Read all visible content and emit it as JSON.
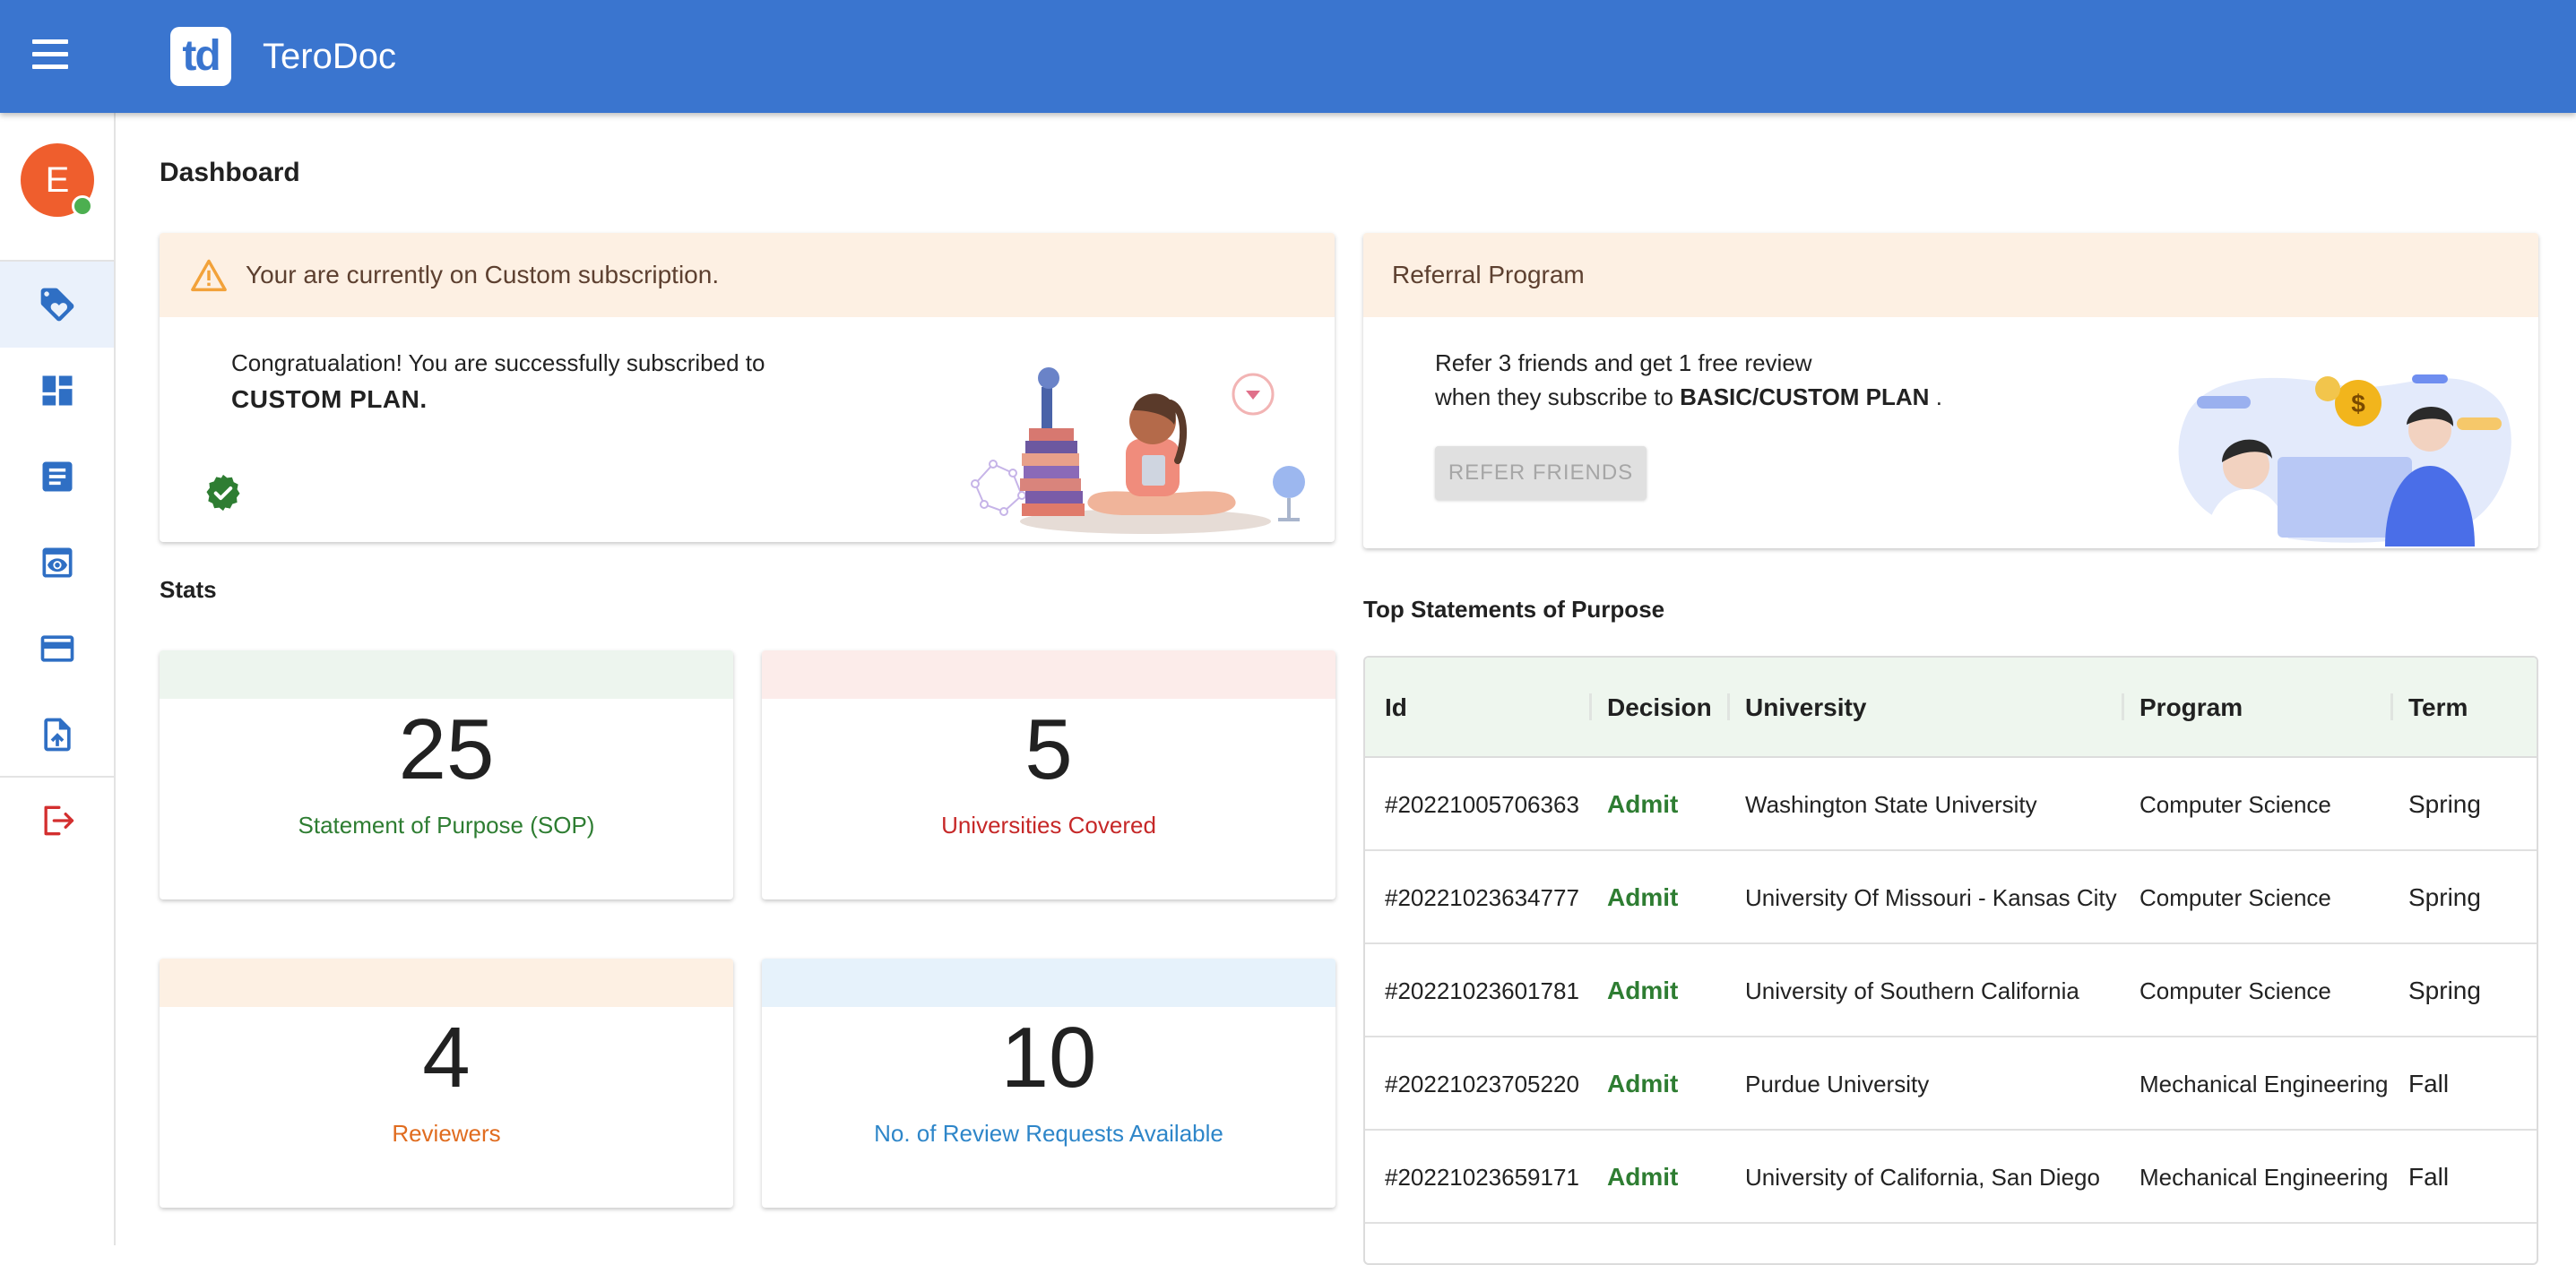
{
  "app": {
    "logo_text": "td",
    "title": "TeroDoc"
  },
  "user": {
    "avatar_initial": "E",
    "status": "online"
  },
  "sidebar": {
    "items": [
      {
        "icon": "tag-heart-icon",
        "active": true
      },
      {
        "icon": "dashboard-icon",
        "active": false
      },
      {
        "icon": "document-icon",
        "active": false
      },
      {
        "icon": "preview-eye-icon",
        "active": false
      },
      {
        "icon": "credit-card-icon",
        "active": false
      },
      {
        "icon": "file-upload-icon",
        "active": false
      },
      {
        "icon": "logout-icon",
        "active": false
      }
    ]
  },
  "page": {
    "title": "Dashboard"
  },
  "subscription": {
    "alert": "Your are currently on Custom subscription.",
    "message": "Congratualation! You are successfully subscribed to",
    "plan": "CUSTOM PLAN.",
    "icon": "verified-badge-icon",
    "alert_icon": "warning-icon"
  },
  "referral": {
    "title": "Referral Program",
    "line1": "Refer 3 friends and get 1 free review",
    "line2_prefix": "when they subscribe to ",
    "line2_bold": "BASIC/CUSTOM PLAN",
    "line2_suffix": " .",
    "button": "REFER FRIENDS"
  },
  "stats": {
    "title": "Stats",
    "items": [
      {
        "value": "25",
        "label": "Statement of Purpose (SOP)",
        "band_color": "#edf5ee",
        "label_color": "#2e7d32"
      },
      {
        "value": "5",
        "label": "Universities Covered",
        "band_color": "#fcecea",
        "label_color": "#c62828"
      },
      {
        "value": "4",
        "label": "Reviewers",
        "band_color": "#fdf0e3",
        "label_color": "#e06c1f"
      },
      {
        "value": "10",
        "label": "No. of Review Requests Available",
        "band_color": "#e6f2fb",
        "label_color": "#2e86c9"
      }
    ]
  },
  "top_sop": {
    "title": "Top Statements of Purpose",
    "columns": [
      "Id",
      "Decision",
      "University",
      "Program",
      "Term"
    ],
    "rows": [
      {
        "id": "#20221005706363",
        "decision": "Admit",
        "university": "Washington State University",
        "program": "Computer Science",
        "term": "Spring"
      },
      {
        "id": "#20221023634777",
        "decision": "Admit",
        "university": "University Of Missouri - Kansas City",
        "program": "Computer Science",
        "term": "Spring"
      },
      {
        "id": "#20221023601781",
        "decision": "Admit",
        "university": "University of Southern California",
        "program": "Computer Science",
        "term": "Spring"
      },
      {
        "id": "#20221023705220",
        "decision": "Admit",
        "university": "Purdue University",
        "program": "Mechanical Engineering",
        "term": "Fall"
      },
      {
        "id": "#20221023659171",
        "decision": "Admit",
        "university": "University of California, San Diego",
        "program": "Mechanical Engineering",
        "term": "Fall"
      }
    ]
  },
  "colors": {
    "primary": "#3a75cf",
    "admit": "#2e7d32",
    "logout": "#d32f2f"
  }
}
